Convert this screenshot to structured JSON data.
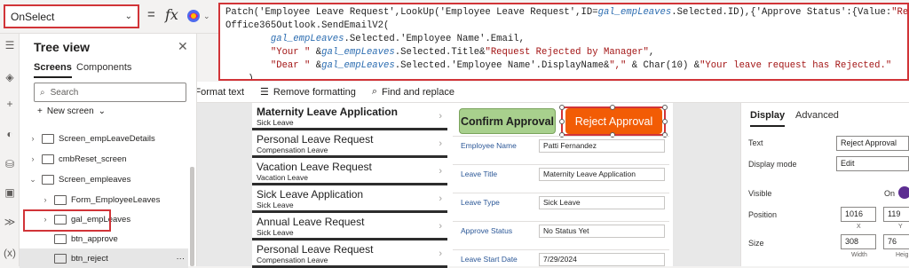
{
  "formula_bar": {
    "property": "OnSelect",
    "eq": "=",
    "fx": "fx",
    "lines": [
      [
        [
          "fn",
          "Patch('Employee Leave Request',LookUp('Employee Leave Request',ID="
        ],
        [
          "var",
          "gal_empLeaves"
        ],
        [
          "fn",
          ".Selected.ID),{'Approve Status':{Value:"
        ],
        [
          "str",
          "\"Rejected\""
        ],
        [
          "fn",
          "}});"
        ]
      ],
      [
        [
          "fn",
          "Office365Outlook.SendEmailV2("
        ]
      ],
      [
        [
          "fn",
          "        "
        ],
        [
          "var",
          "gal_empLeaves"
        ],
        [
          "fn",
          ".Selected.'Employee Name'.Email,"
        ]
      ],
      [
        [
          "fn",
          "        "
        ],
        [
          "str",
          "\"Your \""
        ],
        [
          "fn",
          " &"
        ],
        [
          "var",
          "gal_empLeaves"
        ],
        [
          "fn",
          ".Selected.Title&"
        ],
        [
          "str",
          "\"Request Rejected by Manager\""
        ],
        [
          "fn",
          ","
        ]
      ],
      [
        [
          "fn",
          "        "
        ],
        [
          "str",
          "\"Dear \""
        ],
        [
          "fn",
          " &"
        ],
        [
          "var",
          "gal_empLeaves"
        ],
        [
          "fn",
          ".Selected.'Employee Name'.DisplayName&"
        ],
        [
          "str",
          "\",\""
        ],
        [
          "fn",
          " & Char(10) &"
        ],
        [
          "str",
          "\"Your leave request has Rejected.\""
        ]
      ],
      [
        [
          "fn",
          "    )"
        ]
      ]
    ],
    "format_text": "Format text",
    "remove_formatting": "Remove formatting",
    "find_replace": "Find and replace"
  },
  "tree": {
    "title": "Tree view",
    "tab_screens": "Screens",
    "tab_components": "Components",
    "search_placeholder": "Search",
    "new_screen": "New screen",
    "items": [
      {
        "label": "Screen_empLeaveDetails",
        "chev": "›",
        "indent": 0
      },
      {
        "label": "cmbReset_screen",
        "chev": "›",
        "indent": 0
      },
      {
        "label": "Screen_empleaves",
        "chev": "⌄",
        "indent": 0
      },
      {
        "label": "Form_EmployeeLeaves",
        "chev": "›",
        "indent": 1
      },
      {
        "label": "gal_empLeaves",
        "chev": "›",
        "indent": 1
      },
      {
        "label": "btn_approve",
        "chev": "",
        "indent": 1
      },
      {
        "label": "btn_reject",
        "chev": "",
        "indent": 1
      }
    ],
    "more": "···"
  },
  "gallery": [
    {
      "title": "Maternity Leave Application",
      "sub": "Sick Leave"
    },
    {
      "title": "Personal Leave Request",
      "sub": "Compensation Leave"
    },
    {
      "title": "Vacation Leave Request",
      "sub": "Vacation Leave"
    },
    {
      "title": "Sick Leave Application",
      "sub": "Sick Leave"
    },
    {
      "title": "Annual Leave Request",
      "sub": "Sick Leave"
    },
    {
      "title": "Personal Leave Request",
      "sub": "Compensation Leave"
    }
  ],
  "buttons": {
    "confirm": "Confirm Approval",
    "reject": "Reject Approval"
  },
  "form": [
    {
      "label": "Employee Name",
      "value": "Patti Fernandez"
    },
    {
      "label": "Leave Title",
      "value": "Maternity Leave Application"
    },
    {
      "label": "Leave Type",
      "value": "Sick Leave"
    },
    {
      "label": "Approve Status",
      "value": "No Status Yet"
    },
    {
      "label": "Leave Start Date",
      "value": "7/29/2024"
    }
  ],
  "props": {
    "tab_display": "Display",
    "tab_advanced": "Advanced",
    "text_label": "Text",
    "text_value": "Reject Approval",
    "display_mode_label": "Display mode",
    "display_mode_value": "Edit",
    "visible_label": "Visible",
    "visible_value": "On",
    "position_label": "Position",
    "pos_x": "1016",
    "pos_y": "119",
    "cap_x": "X",
    "cap_y": "Y",
    "size_label": "Size",
    "width": "308",
    "height": "76",
    "cap_w": "Width",
    "cap_h": "Heig"
  }
}
